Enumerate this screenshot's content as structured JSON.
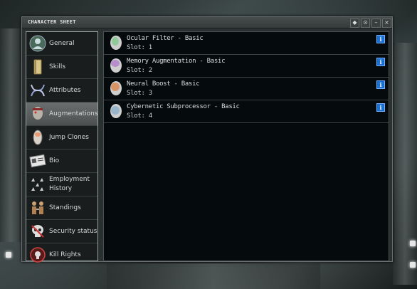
{
  "window": {
    "title": "CHARACTER SHEET",
    "controls": {
      "pin": "◆",
      "options": "⊙",
      "minimize": "–",
      "close": "×"
    }
  },
  "sidebar": {
    "items": [
      {
        "label": "General",
        "icon": "general-icon",
        "active": false
      },
      {
        "label": "Skills",
        "icon": "skills-book-icon",
        "active": false
      },
      {
        "label": "Attributes",
        "icon": "attributes-helix-icon",
        "active": false
      },
      {
        "label": "Augmentations",
        "icon": "augmentations-head-icon",
        "active": true
      },
      {
        "label": "Jump Clones",
        "icon": "jump-clones-icon",
        "active": false
      },
      {
        "label": "Bio",
        "icon": "bio-document-icon",
        "active": false
      },
      {
        "label": "Employment History",
        "icon": "employment-history-icon",
        "active": false
      },
      {
        "label": "Standings",
        "icon": "standings-icon",
        "active": false
      },
      {
        "label": "Security status",
        "icon": "security-status-skull-icon",
        "active": false
      },
      {
        "label": "Kill Rights",
        "icon": "kill-rights-icon",
        "active": false
      }
    ]
  },
  "augmentations": [
    {
      "name": "Ocular Filter - Basic",
      "slot": "Slot: 1",
      "icon_color": "#7ec98a"
    },
    {
      "name": "Memory Augmentation - Basic",
      "slot": "Slot: 2",
      "icon_color": "#b07cc8"
    },
    {
      "name": "Neural Boost - Basic",
      "slot": "Slot: 3",
      "icon_color": "#d88a55"
    },
    {
      "name": "Cybernetic Subprocessor - Basic",
      "slot": "Slot: 4",
      "icon_color": "#8fb0c8"
    }
  ],
  "info_label": "i",
  "colors": {
    "accent": "#1a6fd0",
    "panel_bg": "#050a0c"
  }
}
